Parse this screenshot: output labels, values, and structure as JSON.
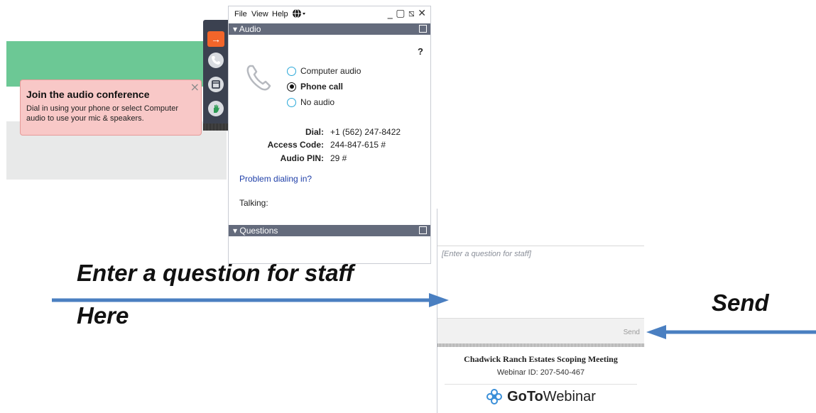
{
  "menu": {
    "file": "File",
    "view": "View",
    "help": "Help",
    "globe_icon": "globe-icon",
    "window_controls": "_ ▢ ⧅ ✕"
  },
  "audio": {
    "section_title": "Audio",
    "help": "?",
    "options": [
      "Computer audio",
      "Phone call",
      "No audio"
    ],
    "selected": "Phone call",
    "dial_label": "Dial:",
    "dial_value": "+1 (562) 247-8422",
    "access_label": "Access Code:",
    "access_value": "244-847-615 #",
    "pin_label": "Audio PIN:",
    "pin_value": "29 #",
    "problem_link": "Problem dialing in?",
    "talking": "Talking:"
  },
  "tooltip": {
    "title": "Join the audio conference",
    "body": "Dial in using your phone or select Computer audio to use your mic & speakers.",
    "close": "×"
  },
  "questions": {
    "section_title": "Questions",
    "placeholder": "[Enter a question for staff]",
    "send": "Send"
  },
  "meeting": {
    "title": "Chadwick Ranch Estates Scoping Meeting",
    "webinar_id": "Webinar ID: 207-540-467"
  },
  "brand": {
    "goto": "GoTo",
    "webinar": "Webinar"
  },
  "annotations": {
    "main": "Enter a question for staff",
    "here": "Here",
    "send": "Send"
  },
  "colors": {
    "accent_orange": "#f2652a",
    "section_bar": "#646b7c",
    "arrow_blue": "#4a7fc1",
    "tooltip_bg": "#f8c8c7",
    "green_bg": "#6cc895"
  }
}
